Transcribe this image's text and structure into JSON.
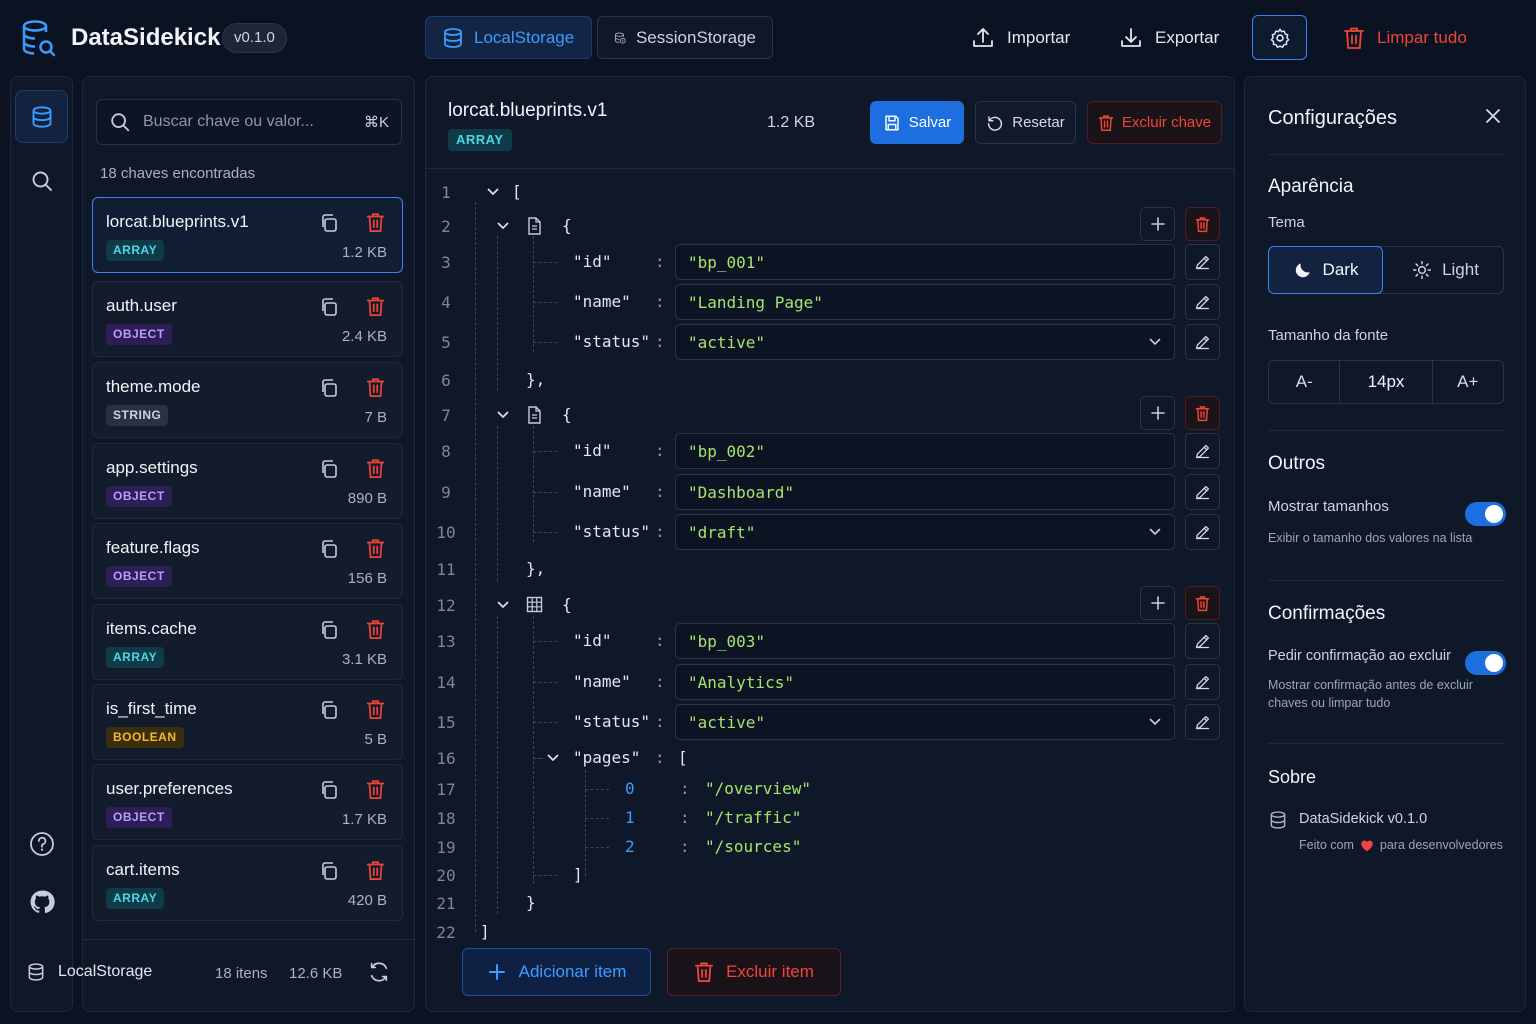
{
  "app": {
    "name": "DataSidekick",
    "version": "v0.1.0"
  },
  "tabs": [
    {
      "label": "LocalStorage",
      "active": true
    },
    {
      "label": "SessionStorage",
      "active": false
    }
  ],
  "toolbar": {
    "import_label": "Importar",
    "export_label": "Exportar",
    "clear_all_label": "Limpar tudo"
  },
  "search": {
    "placeholder": "Buscar chave ou valor...",
    "shortcut": "⌘K"
  },
  "keys_count": "18 chaves encontradas",
  "keys": [
    {
      "name": "lorcat.blueprints.v1",
      "type": "ARRAY",
      "size": "1.2 KB",
      "selected": true
    },
    {
      "name": "auth.user",
      "type": "OBJECT",
      "size": "2.4 KB"
    },
    {
      "name": "theme.mode",
      "type": "STRING",
      "size": "7 B"
    },
    {
      "name": "app.settings",
      "type": "OBJECT",
      "size": "890 B"
    },
    {
      "name": "feature.flags",
      "type": "OBJECT",
      "size": "156 B"
    },
    {
      "name": "items.cache",
      "type": "ARRAY",
      "size": "3.1 KB"
    },
    {
      "name": "is_first_time",
      "type": "BOOLEAN",
      "size": "5 B"
    },
    {
      "name": "user.preferences",
      "type": "OBJECT",
      "size": "1.7 KB"
    },
    {
      "name": "cart.items",
      "type": "ARRAY",
      "size": "420 B"
    }
  ],
  "footer": {
    "storage": "LocalStorage",
    "items": "18 itens",
    "total": "12.6 KB"
  },
  "editor": {
    "key": "lorcat.blueprints.v1",
    "type": "ARRAY",
    "size": "1.2 KB",
    "save_label": "Salvar",
    "reset_label": "Resetar",
    "delete_key_label": "Excluir chave",
    "add_item_label": "Adicionar item",
    "delete_item_label": "Excluir item",
    "blueprints": [
      {
        "id": "\"bp_001\"",
        "name": "\"Landing Page\"",
        "status": "\"active\""
      },
      {
        "id": "\"bp_002\"",
        "name": "\"Dashboard\"",
        "status": "\"draft\""
      },
      {
        "id": "\"bp_003\"",
        "name": "\"Analytics\"",
        "status": "\"active\""
      }
    ],
    "pages_key": "\"pages\"",
    "pages": [
      {
        "index": "0",
        "value": "\"/overview\""
      },
      {
        "index": "1",
        "value": "\"/traffic\""
      },
      {
        "index": "2",
        "value": "\"/sources\""
      }
    ],
    "keys": {
      "id": "\"id\"",
      "name": "\"name\"",
      "status": "\"status\""
    }
  },
  "settings": {
    "title": "Configurações",
    "appearance": "Aparência",
    "theme_label": "Tema",
    "theme_dark": "Dark",
    "theme_light": "Light",
    "theme_selected": "Dark",
    "font_size_label": "Tamanho da fonte",
    "font_dec": "A-",
    "font_value": "14px",
    "font_inc": "A+",
    "others": "Outros",
    "show_sizes_label": "Mostrar tamanhos",
    "show_sizes_desc": "Exibir o tamanho dos valores na lista",
    "show_sizes_on": true,
    "confirmations": "Confirmações",
    "confirm_label": "Pedir confirmação ao excluir",
    "confirm_desc": "Mostrar confirmação antes de excluir chaves ou limpar tudo",
    "confirm_on": true,
    "about": "Sobre",
    "about_app": "DataSidekick v0.1.0",
    "made_with": "Feito com",
    "for_devs": "para desenvolvedores"
  },
  "colors": {
    "accent": "#3b82f6",
    "danger": "#f04438",
    "background": "#0b1221"
  }
}
